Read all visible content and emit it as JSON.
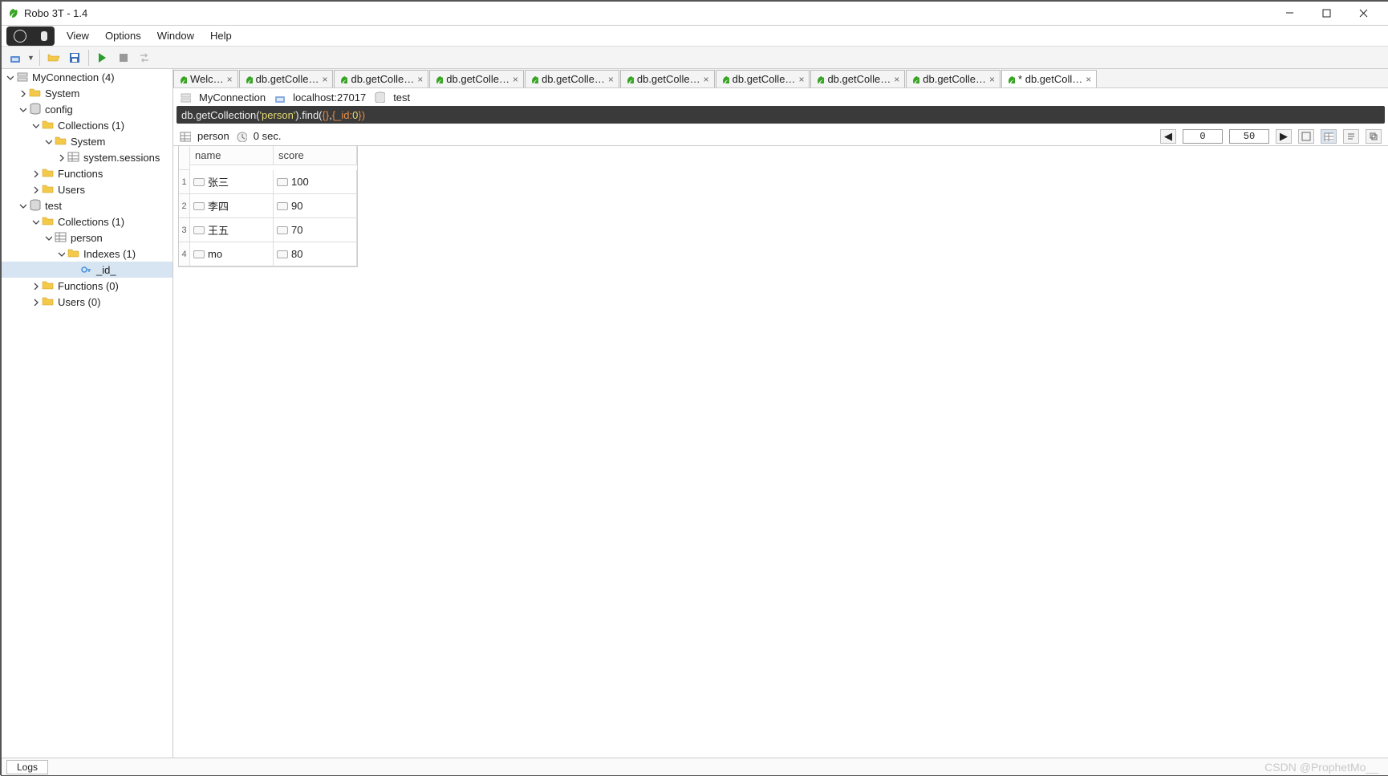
{
  "window": {
    "title": "Robo 3T - 1.4"
  },
  "menu": [
    "View",
    "Options",
    "Window",
    "Help"
  ],
  "tree": {
    "root": "MyConnection (4)",
    "system": "System",
    "config": "config",
    "config_collections": "Collections (1)",
    "config_system": "System",
    "config_sessions": "system.sessions",
    "config_functions": "Functions",
    "config_users": "Users",
    "test": "test",
    "test_collections": "Collections (1)",
    "test_person": "person",
    "test_indexes": "Indexes (1)",
    "test_id": "_id_",
    "test_functions": "Functions (0)",
    "test_users": "Users (0)"
  },
  "tabs": [
    {
      "label": "Welc…",
      "active": false
    },
    {
      "label": "db.getColle…",
      "active": false
    },
    {
      "label": "db.getColle…",
      "active": false
    },
    {
      "label": "db.getColle…",
      "active": false
    },
    {
      "label": "db.getColle…",
      "active": false
    },
    {
      "label": "db.getColle…",
      "active": false
    },
    {
      "label": "db.getColle…",
      "active": false
    },
    {
      "label": "db.getColle…",
      "active": false
    },
    {
      "label": "db.getColle…",
      "active": false
    },
    {
      "label": "* db.getColl…",
      "active": true
    }
  ],
  "crumbs": {
    "conn": "MyConnection",
    "host": "localhost:27017",
    "db": "test"
  },
  "query": {
    "p1": "db.getCollection(",
    "p2": "'person'",
    "p3": ").find(",
    "p4": "{}",
    "p5": ",",
    "p6": "{_id:",
    "p7": "0",
    "p8": "})"
  },
  "result": {
    "label": "person",
    "time": "0 sec.",
    "skip": "0",
    "limit": "50"
  },
  "columns": [
    "name",
    "score"
  ],
  "rows": [
    {
      "n": "1",
      "name": "张三",
      "score": "100"
    },
    {
      "n": "2",
      "name": "李四",
      "score": "90"
    },
    {
      "n": "3",
      "name": "王五",
      "score": "70"
    },
    {
      "n": "4",
      "name": "mo",
      "score": "80"
    }
  ],
  "status": {
    "logs": "Logs",
    "watermark": "CSDN @ProphetMo__"
  }
}
